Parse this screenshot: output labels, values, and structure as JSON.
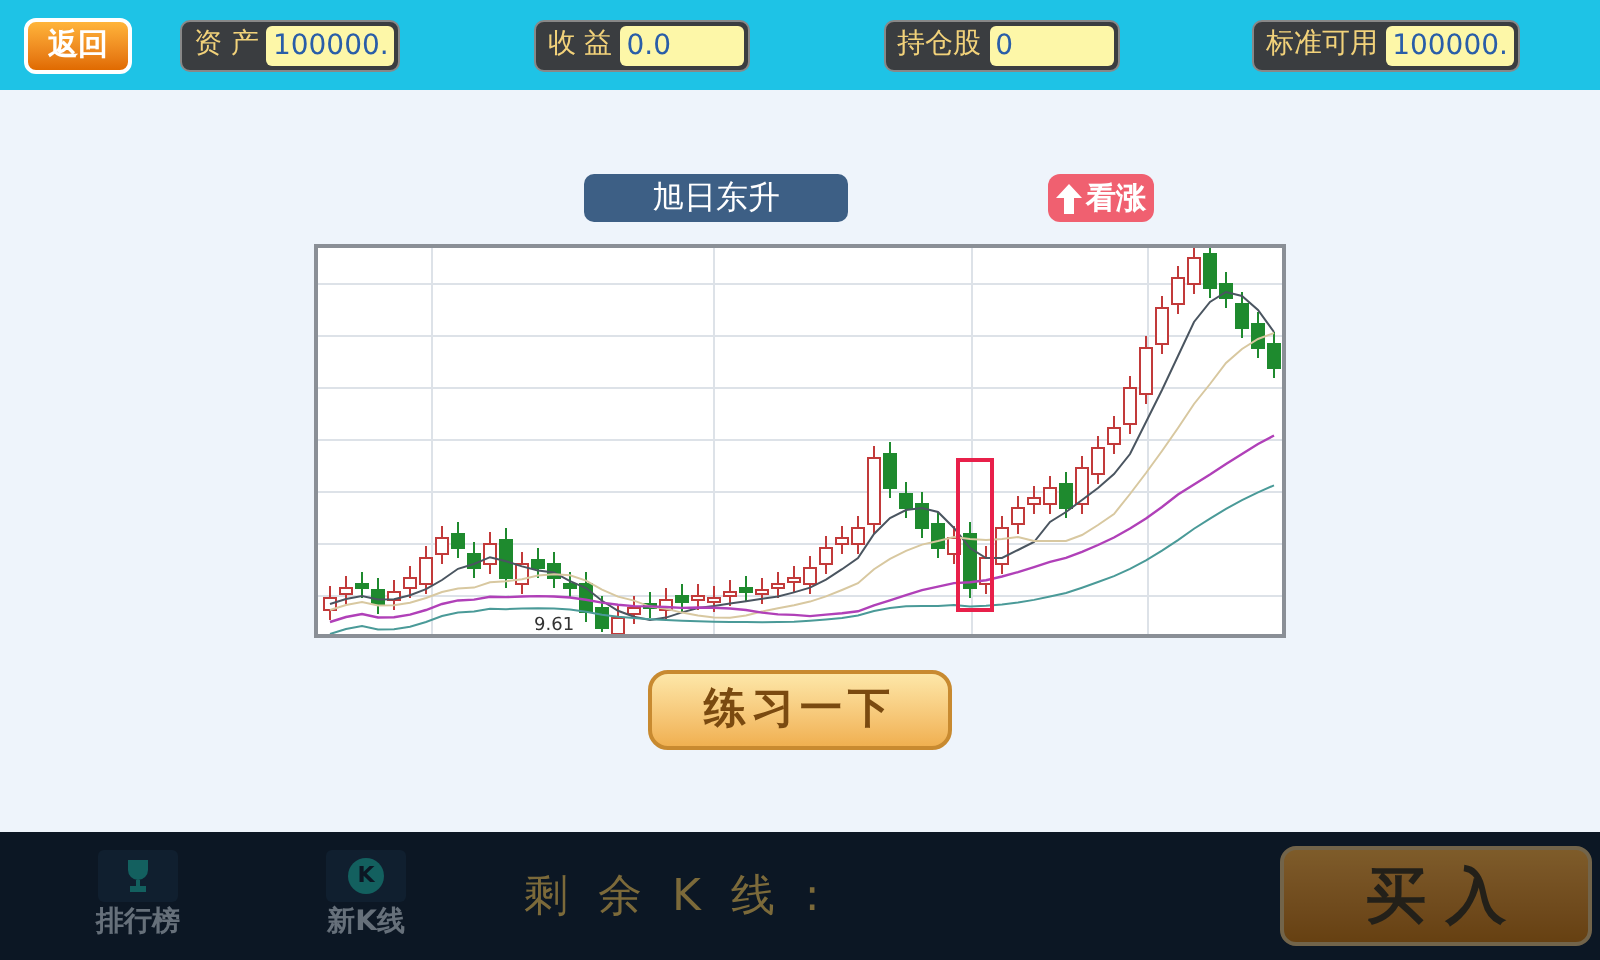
{
  "top_bar": {
    "back_button": "返回",
    "stats": [
      {
        "label": "资 产",
        "value": "100000."
      },
      {
        "label": "收 益",
        "value": "0.0"
      },
      {
        "label": "持仓股",
        "value": "0"
      },
      {
        "label": "标准可用",
        "value": "100000."
      }
    ]
  },
  "pattern": {
    "name": "旭日东升",
    "signal": {
      "label": "看涨",
      "kind": "up"
    }
  },
  "chart": {
    "low_label": "9.61"
  },
  "practice_button": "练习一下",
  "bottom_bar": {
    "nav": [
      {
        "label": "排行榜",
        "kind": "trophy",
        "disabled": true
      },
      {
        "label": "新K线",
        "kind": "letter",
        "icon_text": "K",
        "disabled": true
      }
    ],
    "remaining_label": "剩 余 K 线 :",
    "buy_button": {
      "label": "买 入",
      "disabled": true
    }
  }
}
